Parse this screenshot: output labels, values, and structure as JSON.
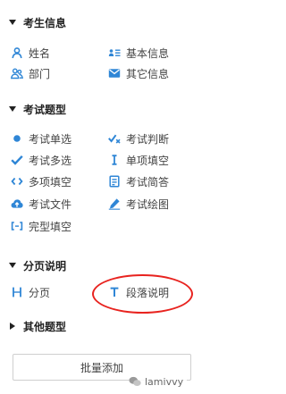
{
  "sections": [
    {
      "title": "考生信息",
      "state": "expanded"
    },
    {
      "title": "考试题型",
      "state": "expanded"
    },
    {
      "title": "分页说明",
      "state": "expanded"
    },
    {
      "title": "其他题型",
      "state": "collapsed"
    }
  ],
  "candidate_info": {
    "name": "姓名",
    "basic_info": "基本信息",
    "department": "部门",
    "other_info": "其它信息"
  },
  "question_types": {
    "single_choice": "考试单选",
    "true_false": "考试判断",
    "multiple_choice": "考试多选",
    "single_fill": "单项填空",
    "multi_fill": "多项填空",
    "short_answer": "考试简答",
    "file_upload": "考试文件",
    "drawing": "考试绘图",
    "cloze": "完型填空"
  },
  "paging": {
    "page_break": "分页",
    "paragraph_desc": "段落说明"
  },
  "batch_add_label": "批量添加",
  "watermark": "lamivvy",
  "colors": {
    "accent": "#2f86d6",
    "highlight": "#e8231f"
  },
  "icons": {
    "name": "person-icon",
    "basic_info": "id-card-icon",
    "department": "group-icon",
    "other_info": "envelope-icon",
    "single_choice": "dot-icon",
    "true_false": "check-cross-icon",
    "multiple_choice": "checkmark-icon",
    "single_fill": "text-cursor-icon",
    "multi_fill": "brackets-icon",
    "short_answer": "note-icon",
    "file_upload": "cloud-upload-icon",
    "drawing": "pen-icon",
    "cloze": "dashed-brackets-icon",
    "page_break": "page-break-icon",
    "paragraph_desc": "text-t-icon"
  }
}
